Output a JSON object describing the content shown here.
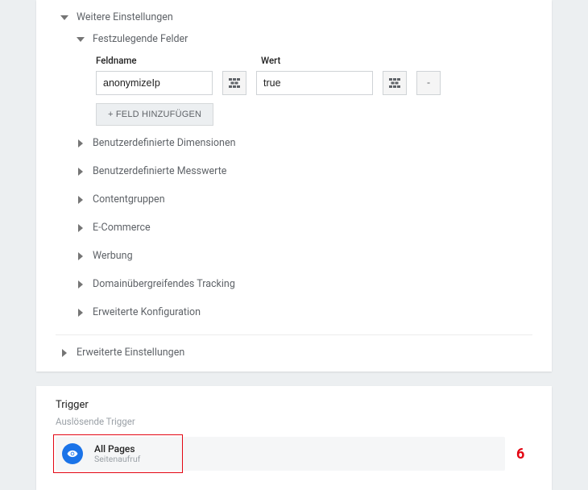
{
  "sections": {
    "more_settings": "Weitere Einstellungen",
    "fields_to_set": "Festzulegende Felder",
    "custom_dimensions": "Benutzerdefinierte Dimensionen",
    "custom_metrics": "Benutzerdefinierte Messwerte",
    "content_groups": "Contentgruppen",
    "ecommerce": "E-Commerce",
    "advertising": "Werbung",
    "cross_domain": "Domainübergreifendes Tracking",
    "advanced_config": "Erweiterte Konfiguration",
    "advanced_settings": "Erweiterte Einstellungen"
  },
  "field_labels": {
    "name": "Feldname",
    "value": "Wert"
  },
  "field_row": {
    "name_value": "anonymizeIp",
    "value_value": "true",
    "remove_label": "-"
  },
  "buttons": {
    "add_field": "+ FELD HINZUFÜGEN"
  },
  "trigger_panel": {
    "heading": "Trigger",
    "subheading": "Auslösende Trigger",
    "item": {
      "name": "All Pages",
      "type": "Seitenaufruf"
    }
  },
  "callout": "6"
}
